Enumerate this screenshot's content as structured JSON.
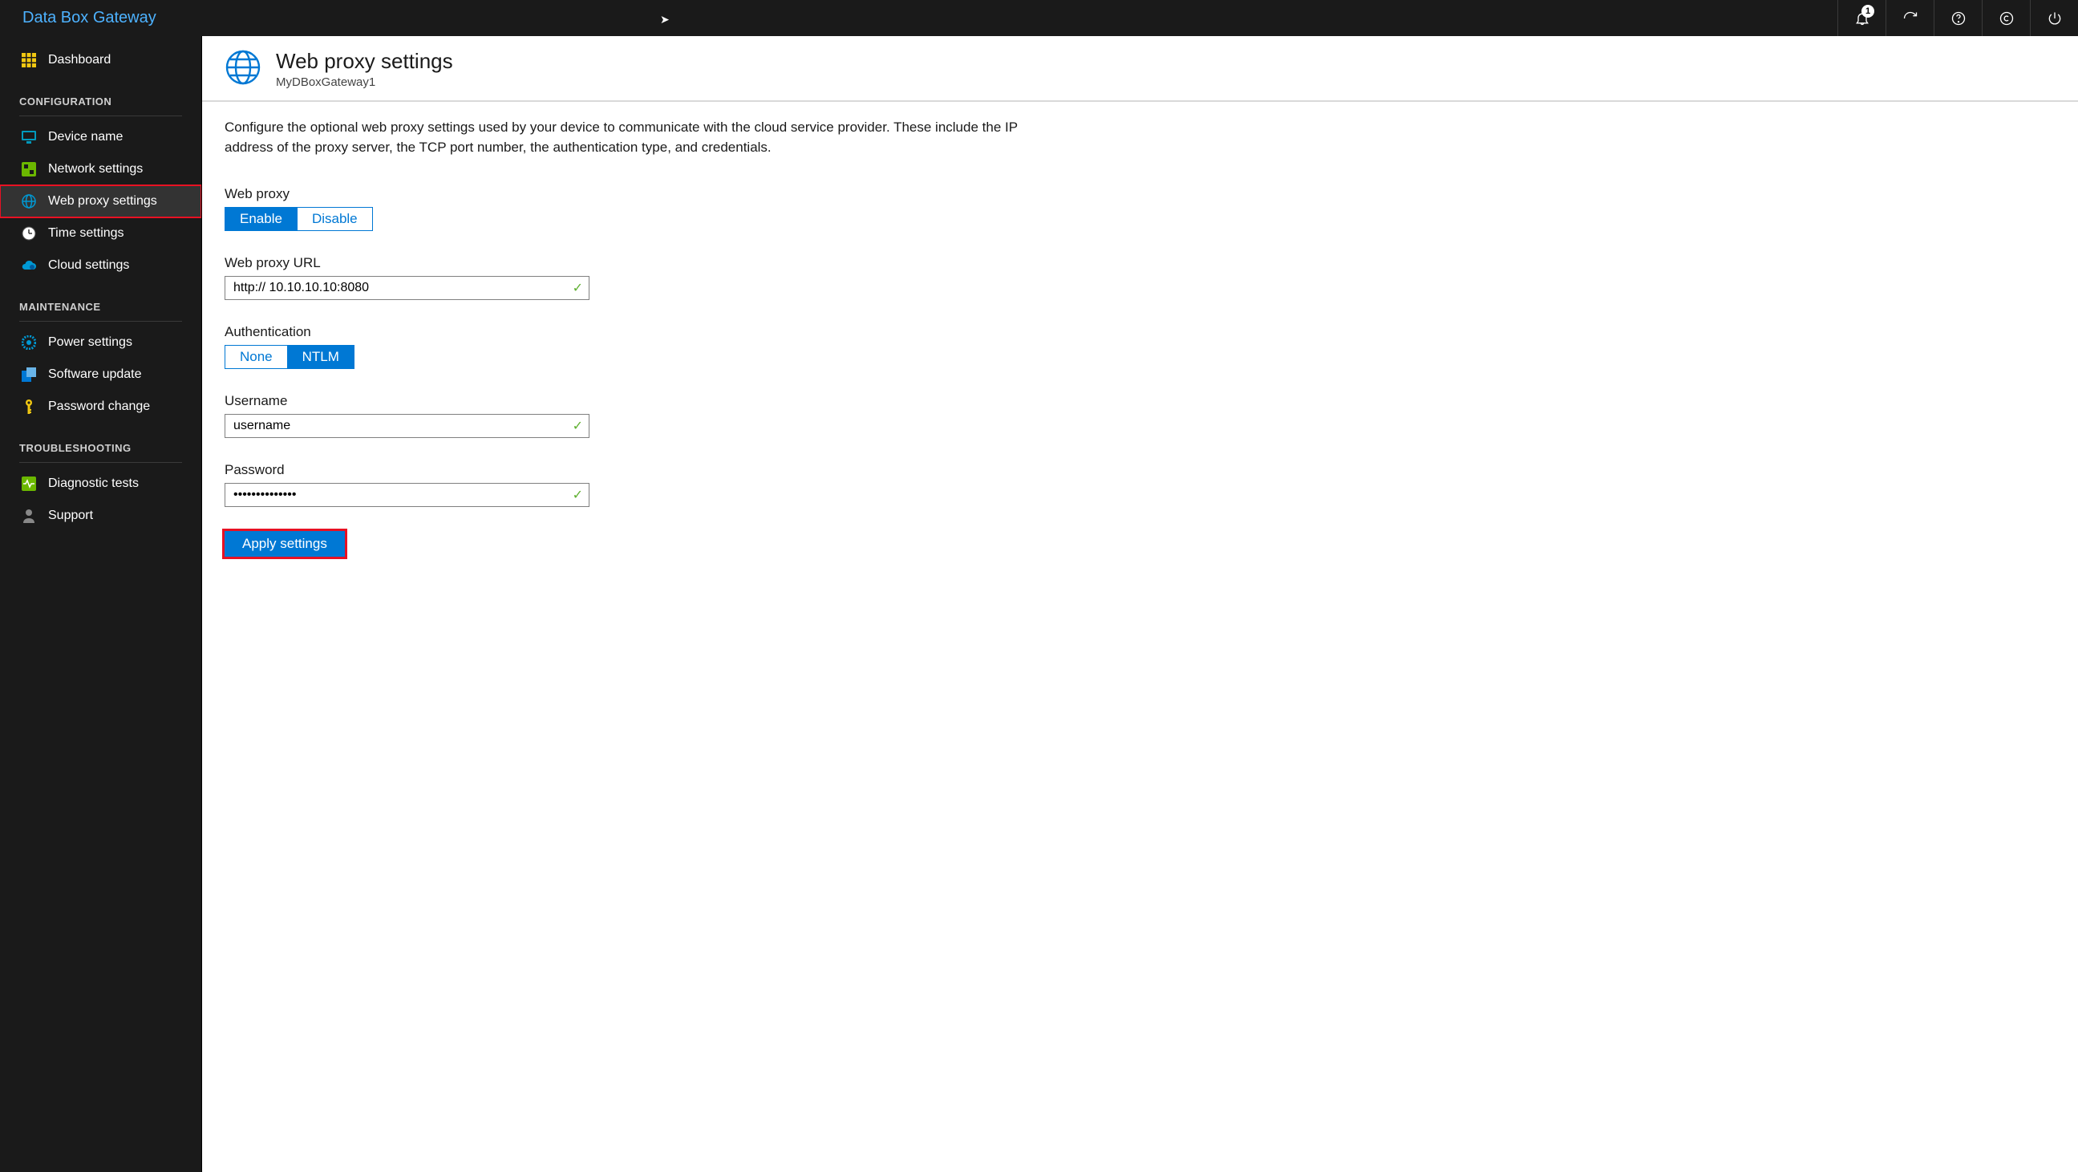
{
  "topbar": {
    "brand": "Data Box Gateway",
    "notification_count": "1"
  },
  "sidebar": {
    "dashboard": "Dashboard",
    "sections": {
      "configuration": {
        "title": "CONFIGURATION",
        "device_name": "Device name",
        "network_settings": "Network settings",
        "web_proxy_settings": "Web proxy settings",
        "time_settings": "Time settings",
        "cloud_settings": "Cloud settings"
      },
      "maintenance": {
        "title": "MAINTENANCE",
        "power_settings": "Power settings",
        "software_update": "Software update",
        "password_change": "Password change"
      },
      "troubleshooting": {
        "title": "TROUBLESHOOTING",
        "diagnostic_tests": "Diagnostic tests",
        "support": "Support"
      }
    }
  },
  "page": {
    "title": "Web proxy settings",
    "subtitle": "MyDBoxGateway1",
    "description": "Configure the optional web proxy settings used by your device to communicate with the cloud service provider. These include the IP address of the proxy server, the TCP port  number, the authentication type, and credentials."
  },
  "form": {
    "web_proxy": {
      "label": "Web proxy",
      "enable": "Enable",
      "disable": "Disable"
    },
    "url": {
      "label": "Web proxy URL",
      "value": "http:// 10.10.10.10:8080"
    },
    "auth": {
      "label": "Authentication",
      "none": "None",
      "ntlm": "NTLM"
    },
    "username": {
      "label": "Username",
      "value": "username"
    },
    "password": {
      "label": "Password",
      "value": "••••••••••••••"
    },
    "apply": "Apply settings"
  }
}
